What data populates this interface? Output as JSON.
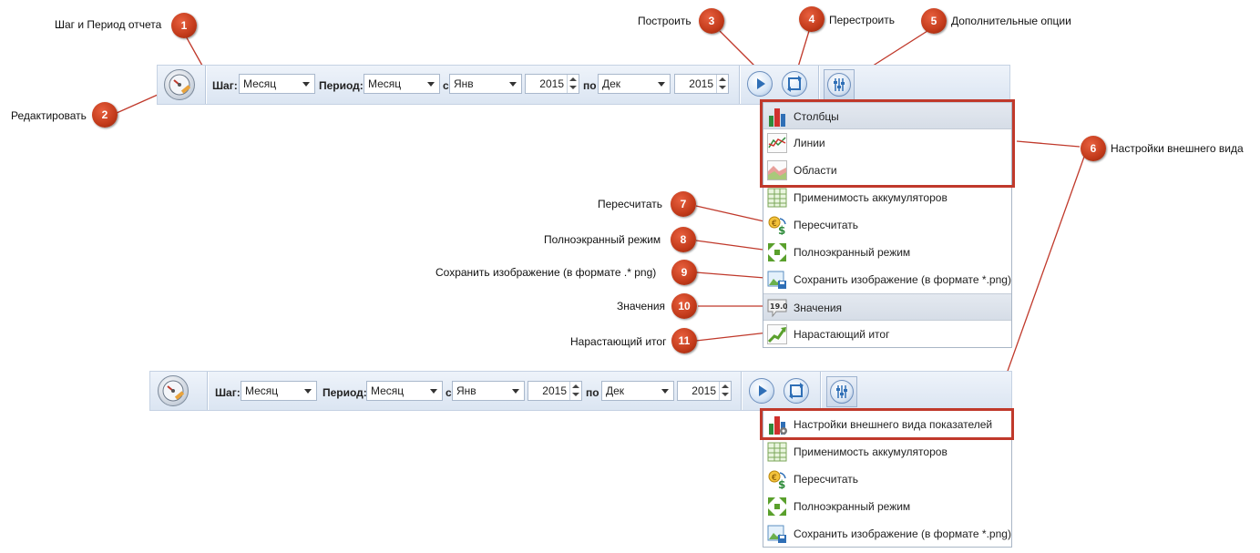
{
  "toolbar": {
    "step_label": "Шаг:",
    "step_value": "Месяц",
    "period_label": "Период:",
    "period_value": "Месяц",
    "from_label": "с",
    "from_month": "Янв",
    "from_year": "2015",
    "to_label": "по",
    "to_month": "Дек",
    "to_year": "2015"
  },
  "menu1": {
    "items": [
      {
        "label": "Столбцы",
        "icon": "bar-chart-icon"
      },
      {
        "label": "Линии",
        "icon": "line-chart-icon"
      },
      {
        "label": "Области",
        "icon": "area-chart-icon"
      },
      {
        "label": "Применимость аккумуляторов",
        "icon": "table-grid-icon"
      },
      {
        "label": "Пересчитать",
        "icon": "recalculate-icon"
      },
      {
        "label": "Полноэкранный режим",
        "icon": "fullscreen-icon"
      },
      {
        "label": "Сохранить изображение (в формате *.png)",
        "icon": "save-image-icon"
      },
      {
        "label": "Значения",
        "icon": "values-icon",
        "icon_text": "19.0"
      },
      {
        "label": "Нарастающий итог",
        "icon": "cumulative-icon"
      }
    ]
  },
  "menu2": {
    "items": [
      {
        "label": "Настройки внешнего вида показателей",
        "icon": "appearance-settings-icon"
      },
      {
        "label": "Применимость аккумуляторов",
        "icon": "table-grid-icon"
      },
      {
        "label": "Пересчитать",
        "icon": "recalculate-icon"
      },
      {
        "label": "Полноэкранный режим",
        "icon": "fullscreen-icon"
      },
      {
        "label": "Сохранить изображение (в формате *.png)",
        "icon": "save-image-icon"
      }
    ]
  },
  "callouts": [
    {
      "num": "1",
      "text": "Шаг и Период отчета"
    },
    {
      "num": "2",
      "text": "Редактировать"
    },
    {
      "num": "3",
      "text": "Построить"
    },
    {
      "num": "4",
      "text": "Перестроить"
    },
    {
      "num": "5",
      "text": "Дополнительные опции"
    },
    {
      "num": "6",
      "text": "Настройки внешнего вида"
    },
    {
      "num": "7",
      "text": "Пересчитать"
    },
    {
      "num": "8",
      "text": "Полноэкранный режим"
    },
    {
      "num": "9",
      "text": "Сохранить изображение (в формате .* png)"
    },
    {
      "num": "10",
      "text": "Значения"
    },
    {
      "num": "11",
      "text": "Нарастающий итог"
    }
  ],
  "colors": {
    "callout_red": "#c0392b",
    "accent_blue": "#2f6fb6"
  }
}
